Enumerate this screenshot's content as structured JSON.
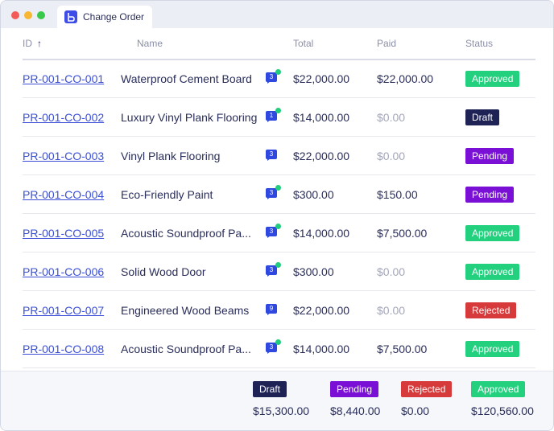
{
  "window": {
    "tab_title": "Change Order"
  },
  "table": {
    "columns": {
      "id": "ID",
      "name": "Name",
      "total": "Total",
      "paid": "Paid",
      "status": "Status"
    },
    "rows": [
      {
        "id": "PR-001-CO-001",
        "name": "Waterproof Cement Board",
        "comments": "3",
        "online": true,
        "total": "$22,000.00",
        "paid": "$22,000.00",
        "paid_zero": false,
        "status": "Approved"
      },
      {
        "id": "PR-001-CO-002",
        "name": "Luxury Vinyl Plank Flooring",
        "comments": "1",
        "online": true,
        "total": "$14,000.00",
        "paid": "$0.00",
        "paid_zero": true,
        "status": "Draft"
      },
      {
        "id": "PR-001-CO-003",
        "name": "Vinyl Plank Flooring",
        "comments": "3",
        "online": false,
        "total": "$22,000.00",
        "paid": "$0.00",
        "paid_zero": true,
        "status": "Pending"
      },
      {
        "id": "PR-001-CO-004",
        "name": "Eco-Friendly Paint",
        "comments": "3",
        "online": true,
        "total": "$300.00",
        "paid": "$150.00",
        "paid_zero": false,
        "status": "Pending"
      },
      {
        "id": "PR-001-CO-005",
        "name": "Acoustic Soundproof Pa...",
        "comments": "3",
        "online": true,
        "total": "$14,000.00",
        "paid": "$7,500.00",
        "paid_zero": false,
        "status": "Approved"
      },
      {
        "id": "PR-001-CO-006",
        "name": "Solid Wood Door",
        "comments": "3",
        "online": true,
        "total": "$300.00",
        "paid": "$0.00",
        "paid_zero": true,
        "status": "Approved"
      },
      {
        "id": "PR-001-CO-007",
        "name": "Engineered Wood Beams",
        "comments": "9",
        "online": false,
        "total": "$22,000.00",
        "paid": "$0.00",
        "paid_zero": true,
        "status": "Rejected"
      },
      {
        "id": "PR-001-CO-008",
        "name": "Acoustic Soundproof Pa...",
        "comments": "3",
        "online": true,
        "total": "$14,000.00",
        "paid": "$7,500.00",
        "paid_zero": false,
        "status": "Approved"
      }
    ]
  },
  "summary": [
    {
      "status": "Draft",
      "amount": "$15,300.00"
    },
    {
      "status": "Pending",
      "amount": "$8,440.00"
    },
    {
      "status": "Rejected",
      "amount": "$0.00"
    },
    {
      "status": "Approved",
      "amount": "$120,560.00"
    }
  ],
  "colors": {
    "accent": "#3a4fd6",
    "approved": "#22d07e",
    "draft": "#1e2255",
    "pending": "#7a0fd6",
    "rejected": "#d63a3a"
  },
  "icons": {
    "sort": "arrow-up-icon",
    "comment": "comment-icon",
    "tab": "app-logo-icon"
  }
}
